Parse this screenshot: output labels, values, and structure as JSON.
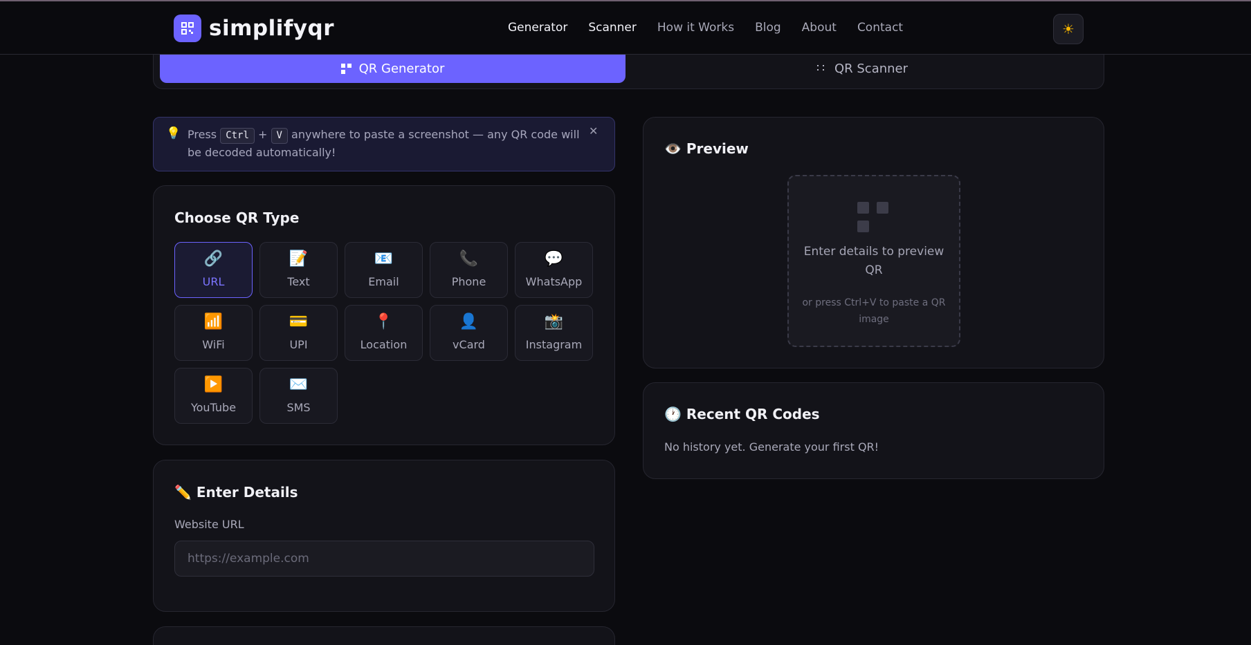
{
  "header": {
    "brand": "simplifyqr",
    "nav": [
      "Generator",
      "Scanner",
      "How it Works",
      "Blog",
      "About",
      "Contact"
    ],
    "active_nav": [
      "Generator",
      "Scanner"
    ],
    "theme_icon": "sun-icon"
  },
  "tabs": {
    "generator_label": "QR Generator",
    "scanner_label": "QR Scanner"
  },
  "notice": {
    "icon": "lightbulb-icon",
    "prefix": "Press",
    "key1": "Ctrl",
    "plus": "+",
    "key2": "V",
    "suffix": "anywhere to paste a screenshot — any QR code will be decoded automatically!",
    "close_icon": "close-icon"
  },
  "qr_type": {
    "title": "Choose QR Type",
    "selected": "URL",
    "types": [
      {
        "label": "URL",
        "icon": "🔗"
      },
      {
        "label": "Text",
        "icon": "📝"
      },
      {
        "label": "Email",
        "icon": "📧"
      },
      {
        "label": "Phone",
        "icon": "📞"
      },
      {
        "label": "WhatsApp",
        "icon": "💬"
      },
      {
        "label": "WiFi",
        "icon": "📶"
      },
      {
        "label": "UPI",
        "icon": "💳"
      },
      {
        "label": "Location",
        "icon": "📍"
      },
      {
        "label": "vCard",
        "icon": "👤"
      },
      {
        "label": "Instagram",
        "icon": "📸"
      },
      {
        "label": "YouTube",
        "icon": "▶️"
      },
      {
        "label": "SMS",
        "icon": "✉️"
      }
    ]
  },
  "details": {
    "title": "✏️ Enter Details",
    "field_label": "Website URL",
    "placeholder": "https://example.com",
    "value": ""
  },
  "preview": {
    "title": "👁️ Preview",
    "main_text": "Enter details to preview QR",
    "sub_text": "or press Ctrl+V to paste a QR image"
  },
  "history": {
    "title": "🕐 Recent QR Codes",
    "empty_text": "No history yet. Generate your first QR!"
  },
  "colors": {
    "accent": "#6c63ff",
    "background": "#0b0b0f",
    "card": "#131319",
    "notice_bg": "#1a1a33"
  }
}
